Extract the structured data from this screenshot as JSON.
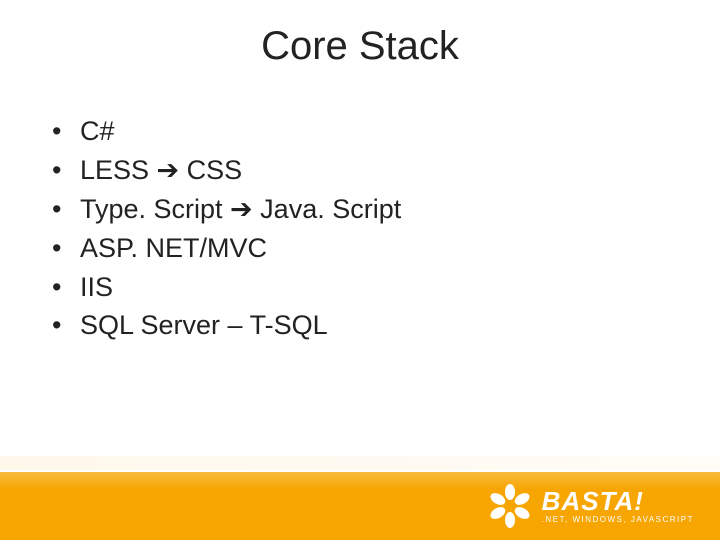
{
  "title": "Core Stack",
  "bullets": [
    "C#",
    "LESS ➔ CSS",
    "Type. Script ➔ Java. Script",
    "ASP. NET/MVC",
    "IIS",
    "SQL Server – T-SQL"
  ],
  "logo": {
    "word": "BASTA!",
    "sub": ".NET, WINDOWS, JAVASCRIPT"
  },
  "colors": {
    "accent": "#f7a500"
  }
}
